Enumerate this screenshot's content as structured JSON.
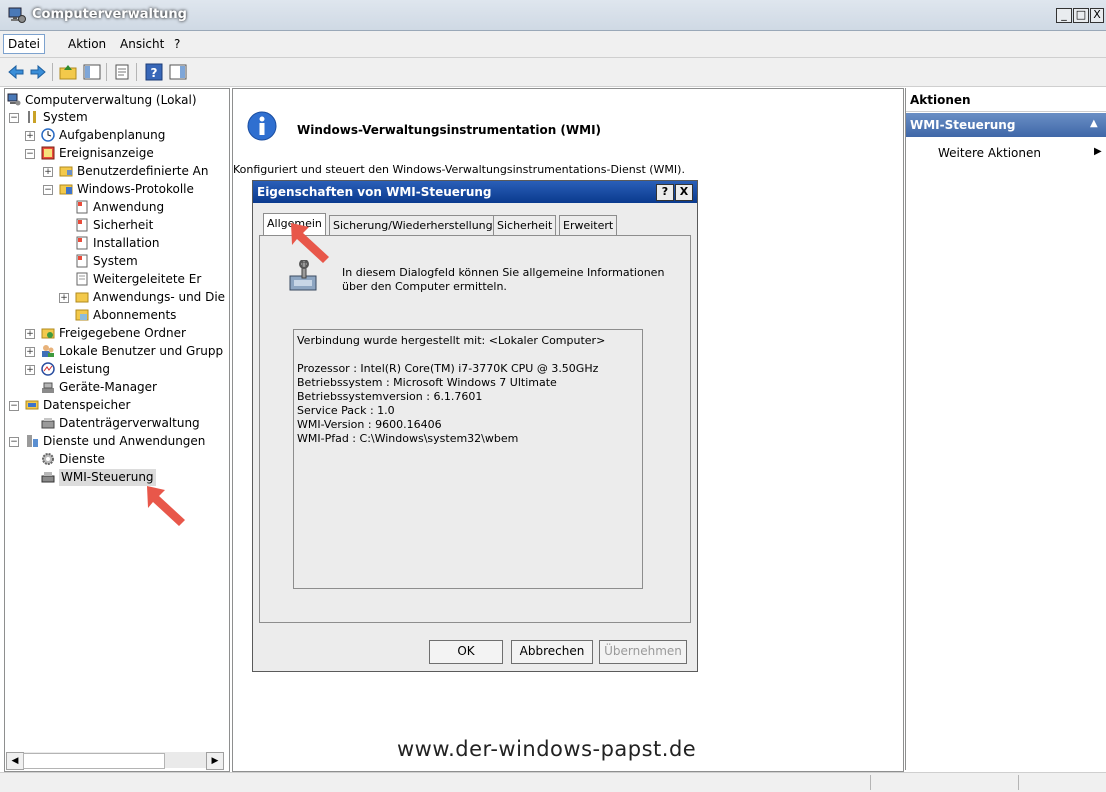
{
  "window": {
    "title": "Computerverwaltung",
    "min": "_",
    "max": "□",
    "close": "X"
  },
  "menu": {
    "items": [
      "Datei",
      "Aktion",
      "Ansicht",
      "?"
    ]
  },
  "tree": {
    "root": "Computerverwaltung (Lokal)",
    "system": "System",
    "aufgaben": "Aufgabenplanung",
    "ereignis": "Ereignisanzeige",
    "benutzerdef": "Benutzerdefinierte An",
    "winprot": "Windows-Protokolle",
    "anwendung": "Anwendung",
    "sicherheit": "Sicherheit",
    "installation": "Installation",
    "system2": "System",
    "weitergeleitet": "Weitergeleitete Er",
    "anwdienste": "Anwendungs- und Die",
    "abonnements": "Abonnements",
    "ordner": "Freigegebene Ordner",
    "lokal": "Lokale Benutzer und Grupp",
    "leistung": "Leistung",
    "geraete": "Geräte-Manager",
    "speicher": "Datenspeicher",
    "datentraeger": "Datenträgerverwaltung",
    "dienstanw": "Dienste und Anwendungen",
    "dienste": "Dienste",
    "wmi": "WMI-Steuerung"
  },
  "middle": {
    "heading": "Windows-Verwaltungsinstrumentation (WMI)",
    "description": "Konfiguriert und steuert den Windows-Verwaltungsinstrumentations-Dienst (WMI).",
    "watermark": "www.der-windows-papst.de"
  },
  "dialog": {
    "title": "Eigenschaften von WMI-Steuerung",
    "help": "?",
    "close": "X",
    "tabs": [
      "Allgemein",
      "Sicherung/Wiederherstellung",
      "Sicherheit",
      "Erweitert"
    ],
    "intro1": "In diesem Dialogfeld können Sie allgemeine Informationen",
    "intro2": "über den Computer ermitteln.",
    "info": [
      "Verbindung wurde hergestellt mit: <Lokaler Computer>",
      "Prozessor :  Intel(R) Core(TM) i7-3770K CPU @ 3.50GHz",
      "Betriebssystem :  Microsoft Windows 7 Ultimate",
      "Betriebssystemversion :  6.1.7601",
      "Service Pack : 1.0",
      "WMI-Version :  9600.16406",
      "WMI-Pfad :  C:\\Windows\\system32\\wbem"
    ],
    "ok": "OK",
    "cancel": "Abbrechen",
    "apply": "Übernehmen"
  },
  "actions": {
    "title": "Aktionen",
    "section": "WMI-Steuerung",
    "more": "Weitere Aktionen"
  },
  "colors": {
    "accent": "#3f67a8",
    "arrow": "#e8574a"
  }
}
